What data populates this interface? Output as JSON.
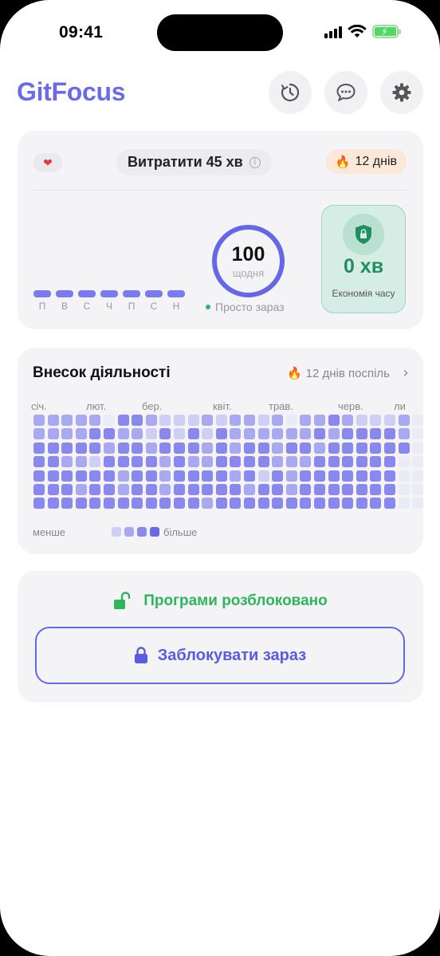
{
  "status_bar": {
    "time": "09:41"
  },
  "header": {
    "app_title": "GitFocus",
    "buttons": [
      "timer-icon",
      "chat-icon",
      "gear-icon"
    ]
  },
  "summary_card": {
    "spend_label": "Витратити 45 хв",
    "streak_label": "12 днів",
    "week_days": [
      "П",
      "В",
      "С",
      "Ч",
      "П",
      "С",
      "Н"
    ],
    "daily_goal_value": "100",
    "daily_goal_unit": "щодня",
    "now_label": "Просто зараз",
    "savings_value": "0 хв",
    "savings_label": "Економія часу"
  },
  "activity_card": {
    "title": "Внесок діяльності",
    "streak_label": "12 днів поспіль",
    "months": [
      "січ.",
      "лют.",
      "бер.",
      "квіт.",
      "трав.",
      "черв.",
      "ли"
    ],
    "legend_less": "менше",
    "legend_more": "більше",
    "levels": [
      "#ebebf7",
      "#cfcff5",
      "#a9a9f1",
      "#8888ee",
      "#6a6ae6"
    ],
    "grid_rows": [
      [
        2,
        2,
        2,
        2,
        2,
        0,
        3,
        3,
        2,
        1,
        1,
        1,
        2,
        1,
        2,
        2,
        1,
        2,
        0,
        2,
        2,
        3,
        2,
        1,
        1,
        1,
        2,
        0
      ],
      [
        2,
        2,
        2,
        2,
        3,
        3,
        2,
        2,
        1,
        3,
        1,
        3,
        1,
        3,
        2,
        2,
        2,
        2,
        2,
        2,
        3,
        2,
        3,
        3,
        3,
        3,
        2,
        0
      ],
      [
        3,
        3,
        3,
        3,
        3,
        2,
        3,
        3,
        2,
        3,
        3,
        3,
        2,
        3,
        2,
        3,
        3,
        2,
        3,
        3,
        2,
        3,
        3,
        3,
        3,
        3,
        3,
        0
      ],
      [
        3,
        3,
        2,
        2,
        1,
        3,
        3,
        3,
        3,
        2,
        3,
        2,
        2,
        3,
        3,
        3,
        3,
        2,
        2,
        2,
        3,
        3,
        3,
        3,
        3,
        3,
        0,
        0
      ],
      [
        3,
        3,
        3,
        3,
        3,
        3,
        2,
        3,
        3,
        2,
        3,
        3,
        3,
        3,
        2,
        3,
        1,
        3,
        2,
        3,
        3,
        3,
        3,
        3,
        3,
        3,
        0,
        0
      ],
      [
        3,
        3,
        3,
        2,
        3,
        3,
        2,
        3,
        3,
        2,
        3,
        3,
        3,
        3,
        3,
        2,
        3,
        3,
        2,
        3,
        3,
        3,
        3,
        3,
        3,
        3,
        0,
        0
      ],
      [
        3,
        3,
        3,
        3,
        3,
        3,
        3,
        3,
        3,
        3,
        3,
        3,
        2,
        3,
        3,
        3,
        3,
        3,
        3,
        3,
        3,
        3,
        3,
        3,
        3,
        3,
        0,
        0
      ]
    ]
  },
  "lock_card": {
    "status_text": "Програми розблоковано",
    "button_label": "Заблокувати зараз"
  }
}
